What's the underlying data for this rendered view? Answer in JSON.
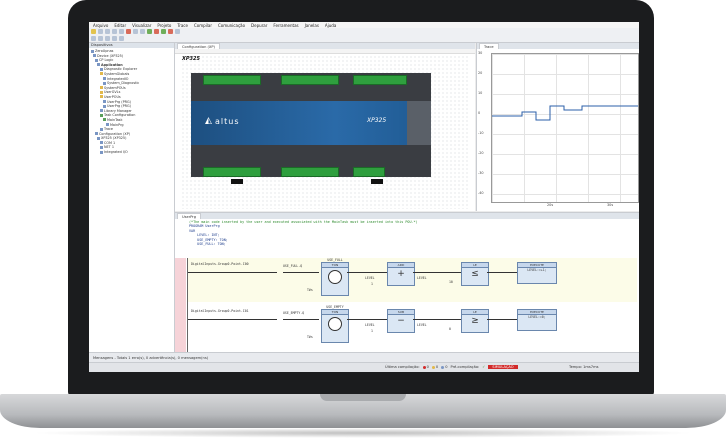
{
  "menu": [
    "Arquivo",
    "Editar",
    "Visualizar",
    "Projeto",
    "Trace",
    "Compilar",
    "Comunicação",
    "Depurar",
    "Ferramentas",
    "Janelas",
    "Ajuda"
  ],
  "devices_panel": {
    "title": "Dispositivos",
    "tree": [
      "ZeroUpnas",
      "Device (XP325)",
      "CP Logic",
      "Application",
      "Diagnostic Explorer",
      "SystemGlobals",
      "IntegratedIO",
      "System_Diagnostic",
      "SystemPOUs",
      "UserGVLs",
      "UserPOUs",
      "UserPrg (PRG)",
      "UserPrg (PRG)",
      "Library Manager",
      "Task Configuration",
      "MainTask",
      "MainPrg",
      "Trace",
      "Configuration (XP)",
      "XP325 (XP325)",
      "COM 1",
      "NET 1",
      "Integrated I/O"
    ]
  },
  "config_tab": "Configuration (XP)",
  "trace_tab": "Trace",
  "device": {
    "model_label": "XP325",
    "brand": "altus",
    "model_face": "XP325"
  },
  "trace": {
    "y_ticks": [
      "30",
      "20",
      "10",
      "0",
      "-10",
      "-20",
      "-30",
      "-40",
      "-50"
    ],
    "x_ticks": [
      "20s",
      "30s"
    ]
  },
  "editor": {
    "tab": "UserPrg",
    "lines": [
      "(*The main code inserted by the user and executed associated with the MainTask must be inserted into this POU.*)",
      "PROGRAM UserPrg",
      "VAR",
      "    LEVEL: INT;",
      "    USE_EMPTY: TON;",
      "    USE_FULL: TON;"
    ],
    "rung1": {
      "contact": "DigitalInputs.Group0.Point.I00",
      "block_top": "USE_FULL",
      "var": "USE_FULL.Q",
      "fb_name": "TON",
      "in": "IN",
      "pt": "PT",
      "q": "Q",
      "et": "ET",
      "time": "T#s",
      "add_title": "ADD",
      "add_op": "+",
      "level_in": "LEVEL",
      "const": "1",
      "level_out": "LEVEL",
      "le_title": "LE",
      "le_op": "≤",
      "le_const": "10",
      "exec_title": "EXECUTE",
      "exec_en": "EN",
      "exec_eno": "ENO",
      "exec_stmt": "LEVEL:=+1;"
    },
    "rung2": {
      "contact": "DigitalInputs.Group0.Point.I01",
      "block_top": "USE_EMPTY",
      "var": "USE_EMPTY.Q",
      "fb_name": "TON",
      "in": "IN",
      "pt": "PT",
      "q": "Q",
      "et": "ET",
      "time": "T#s",
      "sub_title": "SUB",
      "sub_op": "−",
      "level_in": "LEVEL",
      "const": "1",
      "level_out": "LEVEL",
      "ge_title": "LE",
      "ge_op": "≥",
      "ge_const": "0",
      "exec_title": "EXECUTE",
      "exec_en": "EN",
      "exec_eno": "ENO",
      "exec_stmt": "LEVEL:=0;"
    }
  },
  "messages": "Mensagens - Totais 1 erro(s), 0 advertência(s), 0 mensagem(ns)",
  "status": {
    "last_compile": "Última compilação:",
    "counts": [
      "0",
      "0",
      "0"
    ],
    "precompile": "Pré-compilação:",
    "stop_badge": "SIMULAÇÃO",
    "time": "Tempo: 1ms7ms"
  },
  "colors": {
    "accent": "#1d4f80",
    "terminal": "#2f9f3e",
    "trace_line": "#2b5fa8",
    "stop": "#d22b2b"
  }
}
